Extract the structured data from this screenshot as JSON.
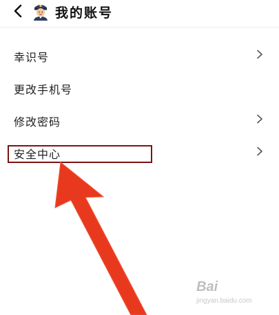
{
  "header": {
    "title": "我的账号",
    "back_icon": "chevron-left-icon",
    "avatar_icon": "police-officer-emoji"
  },
  "settings": {
    "items": [
      {
        "label": "幸识号",
        "has_arrow": true
      },
      {
        "label": "更改手机号",
        "has_arrow": false
      },
      {
        "label": "修改密码",
        "has_arrow": true
      },
      {
        "label": "安全中心",
        "has_arrow": true
      }
    ]
  },
  "annotation": {
    "highlighted_item": "安全中心",
    "color": "#e8391f",
    "box_color": "#7a1212"
  },
  "watermark": {
    "logo": "Bai",
    "sub": "jingyan.baidu.com"
  }
}
